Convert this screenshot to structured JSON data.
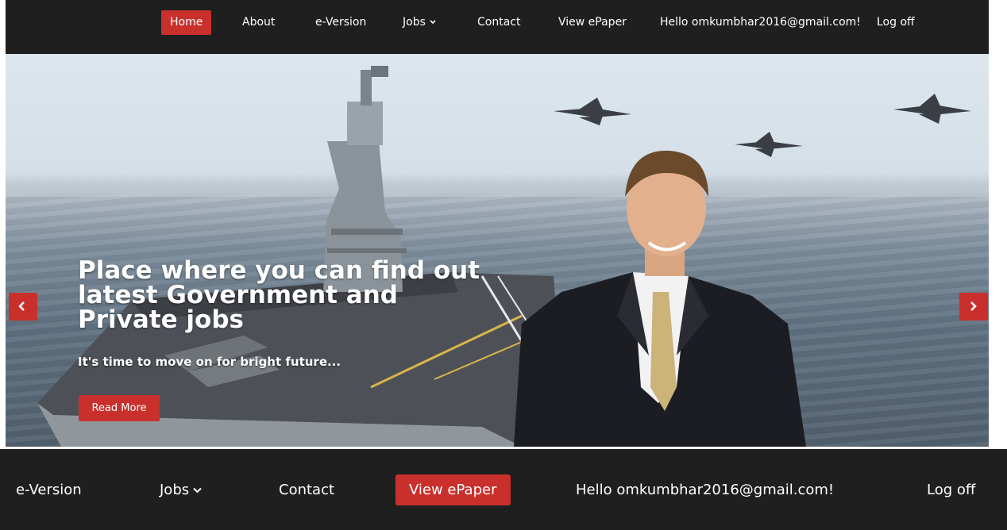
{
  "nav": {
    "home": "Home",
    "about": "About",
    "eversion": "e-Version",
    "jobs": "Jobs",
    "contact": "Contact",
    "epaper": "View ePaper",
    "greeting": "Hello omkumbhar2016@gmail.com!",
    "logoff": "Log off"
  },
  "hero": {
    "headline": "Place where you can find out latest Government and Private jobs",
    "subline": "It's time to move on for bright future...",
    "read_more": "Read More"
  },
  "zoom_nav": {
    "eversion": "e-Version",
    "jobs": "Jobs",
    "contact": "Contact",
    "epaper": "View ePaper",
    "greeting": "Hello omkumbhar2016@gmail.com!",
    "logoff": "Log off"
  },
  "colors": {
    "accent": "#c9302c",
    "navbar": "#1f1f1f"
  },
  "icons": {
    "prev": "chevron-left-icon",
    "next": "chevron-right-icon",
    "dropdown": "chevron-down-icon"
  }
}
